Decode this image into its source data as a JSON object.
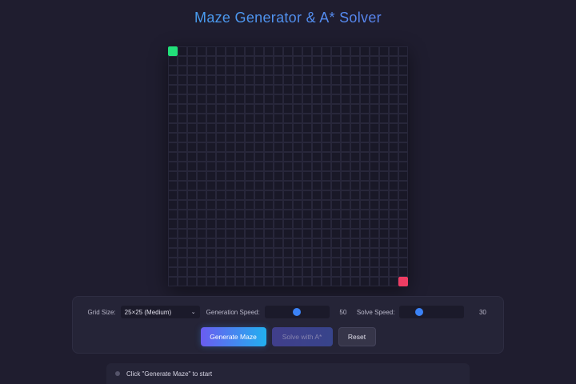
{
  "app": {
    "title": "Maze Generator & A* Solver"
  },
  "maze": {
    "rows": 25,
    "cols": 25,
    "start": [
      0,
      0
    ],
    "end": [
      24,
      24
    ]
  },
  "controls": {
    "grid_size_label": "Grid Size:",
    "grid_size_value": "25×25 (Medium)",
    "generation_speed_label": "Generation Speed:",
    "generation_speed_value": "50",
    "solve_speed_label": "Solve Speed:",
    "solve_speed_value": "30",
    "slider_max": 100
  },
  "buttons": {
    "generate_label": "Generate Maze",
    "solve_label": "Solve with A*",
    "reset_label": "Reset"
  },
  "status": {
    "message": "Click \"Generate Maze\" to start"
  },
  "colors": {
    "start": "#22e07a",
    "end": "#ee3d63",
    "accent": "#3b82f6"
  },
  "icons": {
    "select_chevron": "chevron-down-icon",
    "status_dot": "status-dot-icon"
  }
}
